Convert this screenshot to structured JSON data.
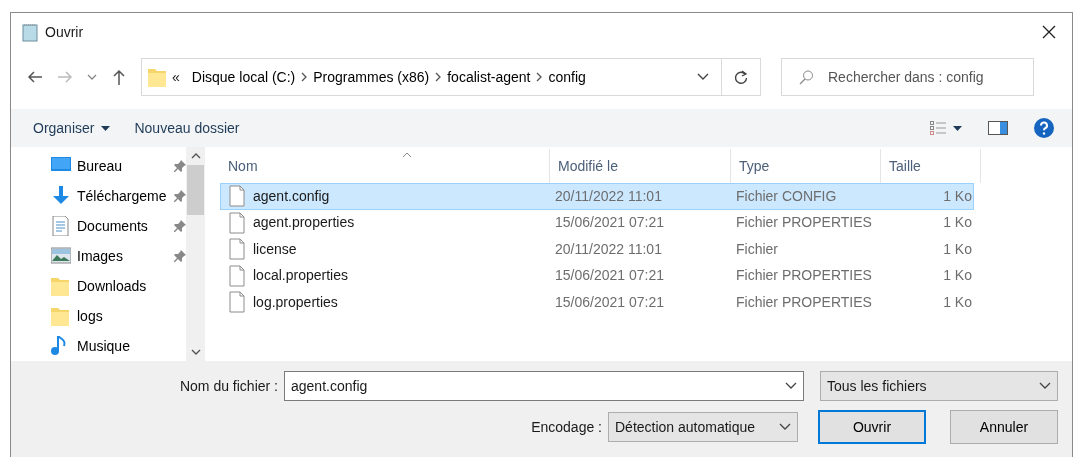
{
  "window": {
    "title": "Ouvrir"
  },
  "address": {
    "overflow": "«",
    "segments": [
      "Disque local (C:)",
      "Programmes (x86)",
      "focalist-agent",
      "config"
    ]
  },
  "search": {
    "placeholder": "Rechercher dans : config"
  },
  "toolbar": {
    "organize": "Organiser",
    "new_folder": "Nouveau dossier"
  },
  "sidebar": {
    "items": [
      {
        "label": "Bureau",
        "kind": "desktop",
        "pinned": true
      },
      {
        "label": "Téléchargeme",
        "kind": "download",
        "pinned": true
      },
      {
        "label": "Documents",
        "kind": "document",
        "pinned": true
      },
      {
        "label": "Images",
        "kind": "pictures",
        "pinned": true
      },
      {
        "label": "Downloads",
        "kind": "folder",
        "pinned": false
      },
      {
        "label": "logs",
        "kind": "folder",
        "pinned": false
      },
      {
        "label": "Musique",
        "kind": "music",
        "pinned": false
      }
    ]
  },
  "table": {
    "columns": [
      "Nom",
      "Modifié le",
      "Type",
      "Taille"
    ],
    "rows": [
      {
        "name": "agent.config",
        "modified": "20/11/2022 11:01",
        "type": "Fichier CONFIG",
        "size": "1 Ko",
        "selected": true
      },
      {
        "name": "agent.properties",
        "modified": "15/06/2021 07:21",
        "type": "Fichier PROPERTIES",
        "size": "1 Ko",
        "selected": false
      },
      {
        "name": "license",
        "modified": "20/11/2022 11:01",
        "type": "Fichier",
        "size": "1 Ko",
        "selected": false
      },
      {
        "name": "local.properties",
        "modified": "15/06/2021 07:21",
        "type": "Fichier PROPERTIES",
        "size": "1 Ko",
        "selected": false
      },
      {
        "name": "log.properties",
        "modified": "15/06/2021 07:21",
        "type": "Fichier PROPERTIES",
        "size": "1 Ko",
        "selected": false
      }
    ]
  },
  "footer": {
    "filename_label": "Nom du fichier :",
    "filename": "agent.config",
    "filter": "Tous les fichiers",
    "encoding_label": "Encodage :",
    "encoding": "Détection automatique",
    "buttons": [
      {
        "label": "Ouvrir",
        "default": true
      },
      {
        "label": "Annuler",
        "default": false
      }
    ]
  }
}
